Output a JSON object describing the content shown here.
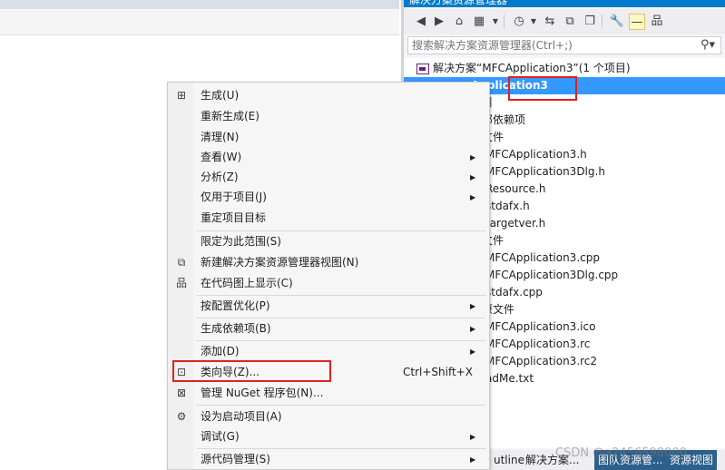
{
  "solution_explorer": {
    "title": "解决方案资源管理器",
    "search_placeholder": "搜索解决方案资源管理器(Ctrl+;)",
    "tree": [
      {
        "label": "解决方案“MFCApplication3”(1 个项目)",
        "selected": false
      },
      {
        "label": "Application3",
        "selected": true
      },
      {
        "label": "引",
        "selected": false
      },
      {
        "label": "部依赖项",
        "selected": false
      },
      {
        "label": "文件",
        "selected": false
      },
      {
        "label": "MFCApplication3.h",
        "selected": false
      },
      {
        "label": "MFCApplication3Dlg.h",
        "selected": false
      },
      {
        "label": "Resource.h",
        "selected": false
      },
      {
        "label": "stdafx.h",
        "selected": false
      },
      {
        "label": "targetver.h",
        "selected": false
      },
      {
        "label": "文件",
        "selected": false
      },
      {
        "label": "MFCApplication3.cpp",
        "selected": false
      },
      {
        "label": "MFCApplication3Dlg.cpp",
        "selected": false
      },
      {
        "label": "stdafx.cpp",
        "selected": false
      },
      {
        "label": "原文件",
        "selected": false
      },
      {
        "label": "MFCApplication3.ico",
        "selected": false
      },
      {
        "label": "MFCApplication3.rc",
        "selected": false
      },
      {
        "label": "MFCApplication3.rc2",
        "selected": false
      },
      {
        "label": "adMe.txt",
        "selected": false
      }
    ],
    "bottom_tabs": [
      "utline",
      "解决方案...",
      "图队资源管...",
      "资源视图"
    ]
  },
  "context_menu": {
    "items": [
      {
        "label": "生成(U)",
        "icon": "build-icon",
        "submenu": false,
        "shortcut": ""
      },
      {
        "label": "重新生成(E)",
        "icon": "",
        "submenu": false,
        "shortcut": ""
      },
      {
        "label": "清理(N)",
        "icon": "",
        "submenu": false,
        "shortcut": ""
      },
      {
        "label": "查看(W)",
        "icon": "",
        "submenu": true,
        "shortcut": ""
      },
      {
        "label": "分析(Z)",
        "icon": "",
        "submenu": true,
        "shortcut": ""
      },
      {
        "label": "仅用于项目(J)",
        "icon": "",
        "submenu": true,
        "shortcut": ""
      },
      {
        "label": "重定项目目标",
        "icon": "",
        "submenu": false,
        "shortcut": ""
      },
      {
        "label": "限定为此范围(S)",
        "icon": "",
        "submenu": false,
        "shortcut": ""
      },
      {
        "label": "新建解决方案资源管理器视图(N)",
        "icon": "new-view-icon",
        "submenu": false,
        "shortcut": ""
      },
      {
        "label": "在代码图上显示(C)",
        "icon": "code-map-icon",
        "submenu": false,
        "shortcut": ""
      },
      {
        "label": "按配置优化(P)",
        "icon": "",
        "submenu": true,
        "shortcut": ""
      },
      {
        "label": "生成依赖项(B)",
        "icon": "",
        "submenu": true,
        "shortcut": ""
      },
      {
        "label": "添加(D)",
        "icon": "",
        "submenu": true,
        "shortcut": ""
      },
      {
        "label": "类向导(Z)...",
        "icon": "class-wizard-icon",
        "submenu": false,
        "shortcut": "Ctrl+Shift+X"
      },
      {
        "label": "管理 NuGet 程序包(N)...",
        "icon": "nuget-icon",
        "submenu": false,
        "shortcut": ""
      },
      {
        "label": "设为启动项目(A)",
        "icon": "gear-icon",
        "submenu": false,
        "shortcut": ""
      },
      {
        "label": "调试(G)",
        "icon": "",
        "submenu": true,
        "shortcut": ""
      },
      {
        "label": "源代码管理(S)",
        "icon": "",
        "submenu": true,
        "shortcut": ""
      }
    ]
  },
  "watermark": "CSDN @a2456598000",
  "colors": {
    "selection": "#3399ff",
    "highlight_box": "#e02020",
    "title_bar": "#007acc"
  }
}
